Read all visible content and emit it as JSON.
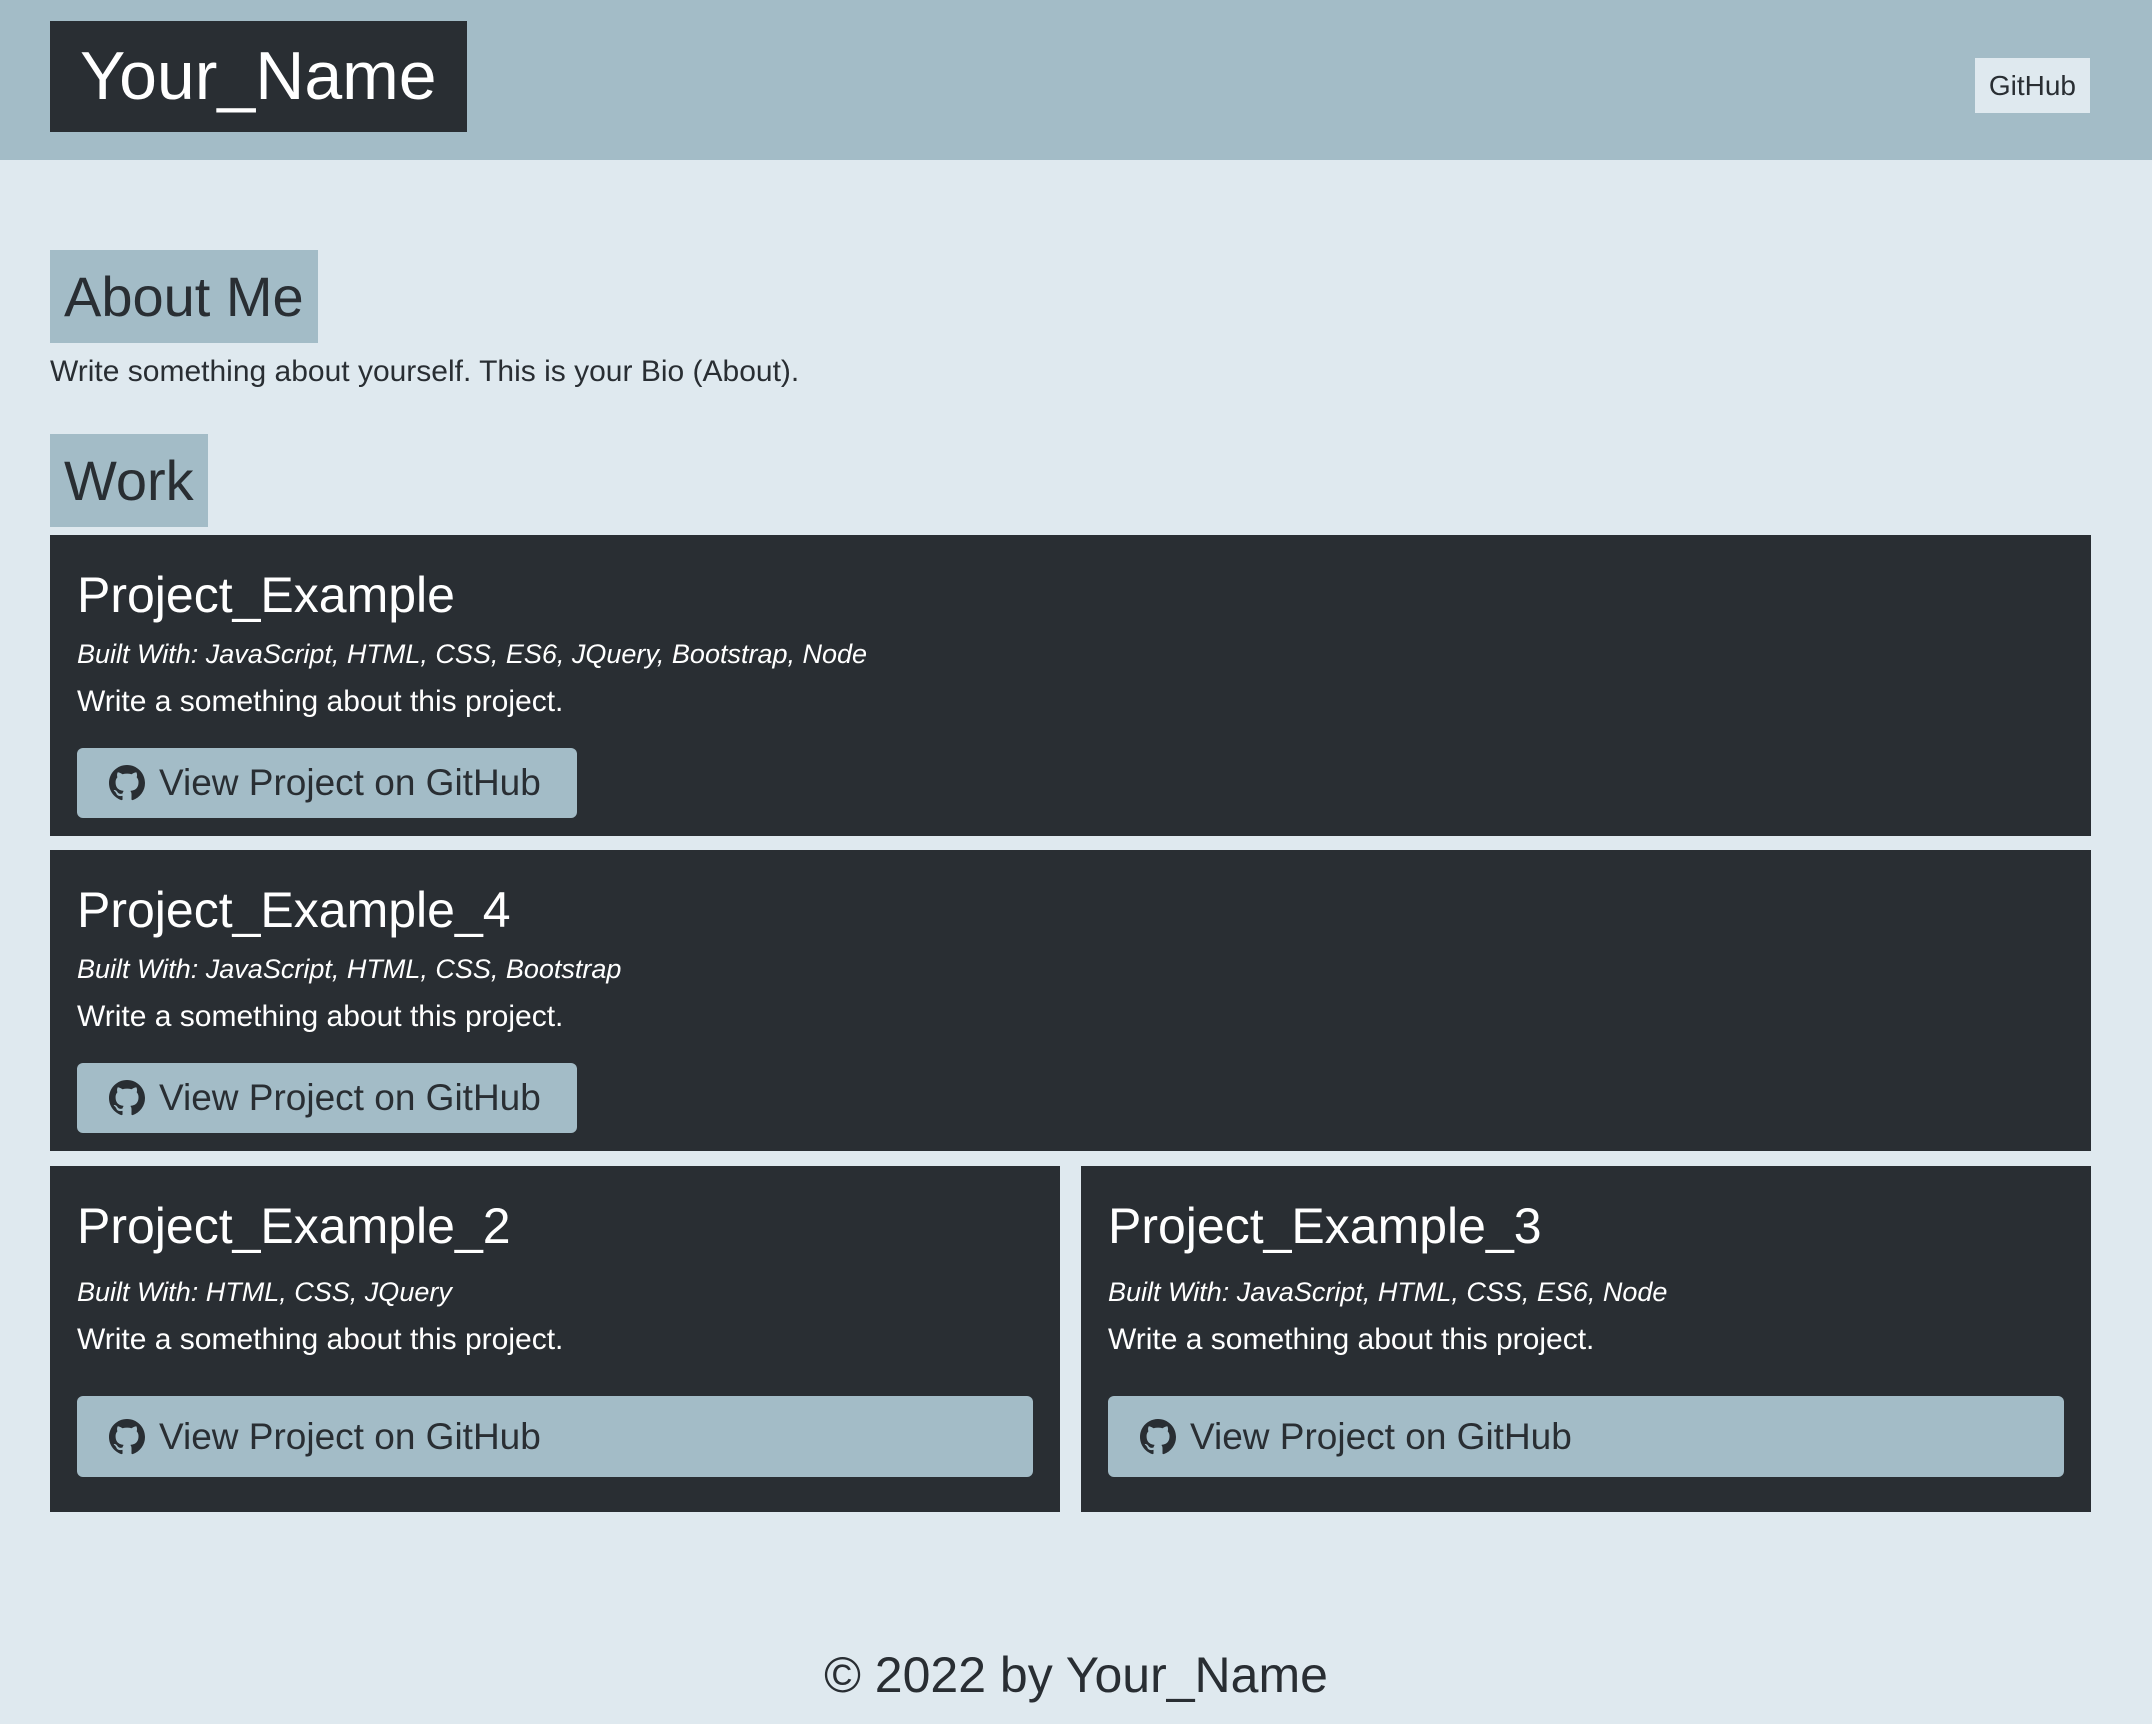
{
  "header": {
    "brand": "Your_Name",
    "nav_link": "GitHub"
  },
  "about": {
    "title": "About Me",
    "bio": "Write something about yourself. This is your Bio (About)."
  },
  "work": {
    "title": "Work",
    "projects": [
      {
        "title": "Project_Example",
        "built_with": "Built With: JavaScript, HTML, CSS, ES6, JQuery, Bootstrap, Node",
        "description": "Write a something about this project.",
        "button": "View Project on GitHub"
      },
      {
        "title": "Project_Example_4",
        "built_with": "Built With: JavaScript, HTML, CSS, Bootstrap",
        "description": "Write a something about this project.",
        "button": "View Project on GitHub"
      },
      {
        "title": "Project_Example_2",
        "built_with": "Built With: HTML, CSS, JQuery",
        "description": "Write a something about this project.",
        "button": "View Project on GitHub"
      },
      {
        "title": "Project_Example_3",
        "built_with": "Built With: JavaScript, HTML, CSS, ES6, Node",
        "description": "Write a something about this project.",
        "button": "View Project on GitHub"
      }
    ]
  },
  "footer": {
    "text": "© 2022 by Your_Name"
  },
  "icons": {
    "project_button_icon": "github-icon"
  },
  "colors": {
    "page_background": "#dfe9ef",
    "header_background": "#a3bcc7",
    "dark": "#292e33",
    "accent": "#a3bcc7"
  }
}
